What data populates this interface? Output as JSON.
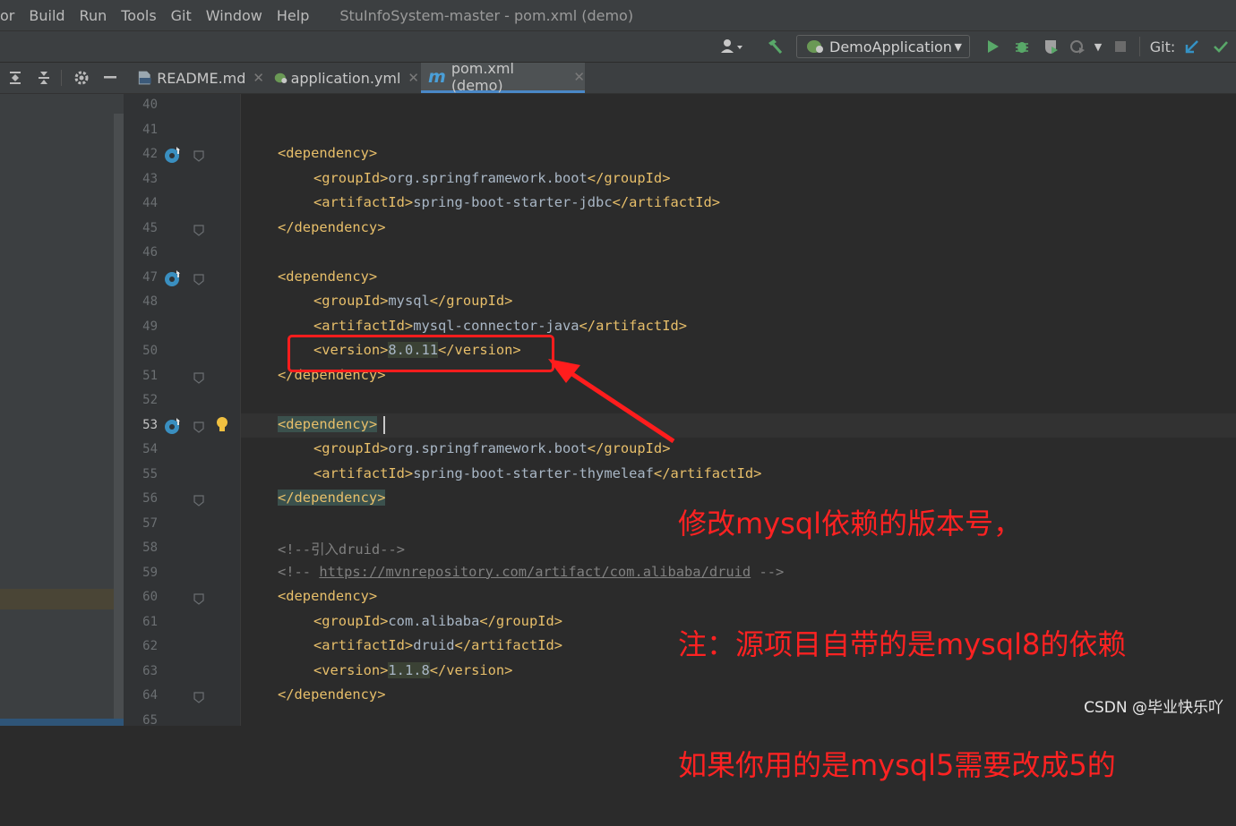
{
  "menu": {
    "items": [
      "or",
      "Build",
      "Run",
      "Tools",
      "Git",
      "Window",
      "Help"
    ],
    "window_title": "StuInfoSystem-master - pom.xml (demo)"
  },
  "toolbar": {
    "run_config": "DemoApplication",
    "git_label": "Git:",
    "icons": [
      "user-icon",
      "hammer-icon",
      "run-icon",
      "debug-icon",
      "coverage-icon",
      "profile-icon",
      "stop-icon",
      "git-update-icon",
      "git-commit-icon"
    ]
  },
  "tabs": [
    {
      "label": "README.md",
      "icon": "md-file-icon",
      "active": false
    },
    {
      "label": "application.yml",
      "icon": "spring-yml-icon",
      "active": false
    },
    {
      "label": "pom.xml (demo)",
      "icon": "maven-icon",
      "active": true
    }
  ],
  "editor": {
    "current_line": 53,
    "lines": [
      {
        "n": "40",
        "segs": []
      },
      {
        "n": "41",
        "segs": []
      },
      {
        "n": "42",
        "segs": [
          {
            "t": "<dependency>",
            "c": "tag"
          }
        ]
      },
      {
        "n": "43",
        "segs": [
          {
            "t": "<groupId>",
            "c": "tag"
          },
          {
            "t": "org.springframework.boot",
            "c": "txt"
          },
          {
            "t": "</groupId>",
            "c": "tag"
          }
        ]
      },
      {
        "n": "44",
        "segs": [
          {
            "t": "<artifactId>",
            "c": "tag"
          },
          {
            "t": "spring-boot-starter-jdbc",
            "c": "txt"
          },
          {
            "t": "</artifactId>",
            "c": "tag"
          }
        ]
      },
      {
        "n": "45",
        "segs": [
          {
            "t": "</dependency>",
            "c": "tag"
          }
        ]
      },
      {
        "n": "46",
        "segs": []
      },
      {
        "n": "47",
        "segs": [
          {
            "t": "<dependency>",
            "c": "tag"
          }
        ]
      },
      {
        "n": "48",
        "segs": [
          {
            "t": "<groupId>",
            "c": "tag"
          },
          {
            "t": "mysql",
            "c": "txt"
          },
          {
            "t": "</groupId>",
            "c": "tag"
          }
        ]
      },
      {
        "n": "49",
        "segs": [
          {
            "t": "<artifactId>",
            "c": "tag"
          },
          {
            "t": "mysql-connector-java",
            "c": "txt"
          },
          {
            "t": "</artifactId>",
            "c": "tag"
          }
        ]
      },
      {
        "n": "50",
        "segs": [
          {
            "t": "<version>",
            "c": "tag"
          },
          {
            "t": "8.0.11",
            "c": "val"
          },
          {
            "t": "</version>",
            "c": "tag"
          }
        ]
      },
      {
        "n": "51",
        "segs": [
          {
            "t": "</dependency>",
            "c": "tag"
          }
        ]
      },
      {
        "n": "52",
        "segs": []
      },
      {
        "n": "53",
        "segs": [
          {
            "t": "<dependency>",
            "c": "taghl"
          }
        ]
      },
      {
        "n": "54",
        "segs": [
          {
            "t": "<groupId>",
            "c": "tag"
          },
          {
            "t": "org.springframework.boot",
            "c": "txt"
          },
          {
            "t": "</groupId>",
            "c": "tag"
          }
        ]
      },
      {
        "n": "55",
        "segs": [
          {
            "t": "<artifactId>",
            "c": "tag"
          },
          {
            "t": "spring-boot-starter-thymeleaf",
            "c": "txt"
          },
          {
            "t": "</artifactId>",
            "c": "tag"
          }
        ]
      },
      {
        "n": "56",
        "segs": [
          {
            "t": "</dependency>",
            "c": "taghl"
          }
        ]
      },
      {
        "n": "57",
        "segs": []
      },
      {
        "n": "58",
        "segs": [
          {
            "t": "<!--引入druid-->",
            "c": "cmt"
          }
        ]
      },
      {
        "n": "59",
        "segs": [
          {
            "t": "<!-- ",
            "c": "cmt"
          },
          {
            "t": "https://mvnrepository.com/artifact/com.alibaba/druid",
            "c": "lnk"
          },
          {
            "t": " -->",
            "c": "cmt"
          }
        ]
      },
      {
        "n": "60",
        "segs": [
          {
            "t": "<dependency>",
            "c": "tag"
          }
        ]
      },
      {
        "n": "61",
        "segs": [
          {
            "t": "<groupId>",
            "c": "tag"
          },
          {
            "t": "com.alibaba",
            "c": "txt"
          },
          {
            "t": "</groupId>",
            "c": "tag"
          }
        ]
      },
      {
        "n": "62",
        "segs": [
          {
            "t": "<artifactId>",
            "c": "tag"
          },
          {
            "t": "druid",
            "c": "txt"
          },
          {
            "t": "</artifactId>",
            "c": "tag"
          }
        ]
      },
      {
        "n": "63",
        "segs": [
          {
            "t": "<version>",
            "c": "tag"
          },
          {
            "t": "1.1.8",
            "c": "val"
          },
          {
            "t": "</version>",
            "c": "tag"
          }
        ]
      },
      {
        "n": "64",
        "segs": [
          {
            "t": "</dependency>",
            "c": "tag"
          }
        ]
      },
      {
        "n": "65",
        "segs": []
      }
    ]
  },
  "annotation": {
    "lines": [
      "修改mysql依赖的版本号，",
      "注：源项目自带的是mysql8的依赖",
      "如果你用的是mysql5需要改成5的"
    ],
    "color": "#ff2222"
  },
  "watermark": "CSDN @毕业快乐吖"
}
